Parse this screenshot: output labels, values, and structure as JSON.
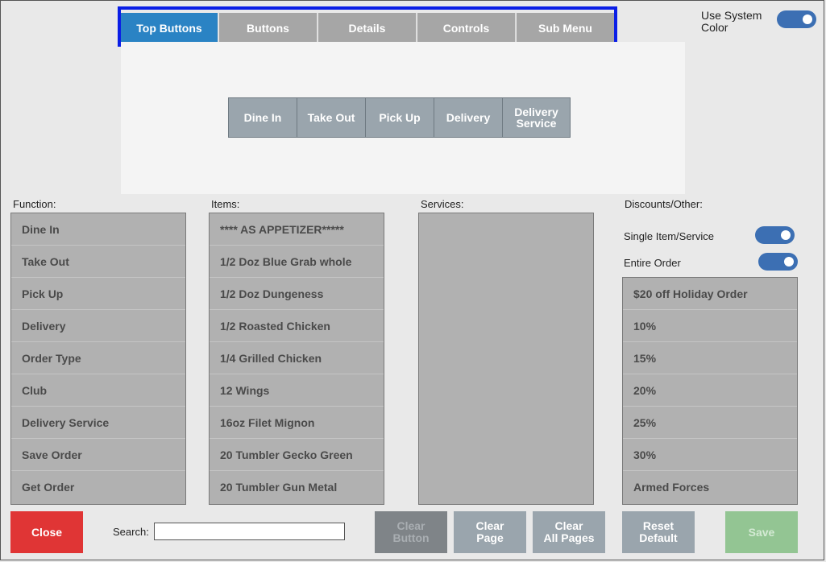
{
  "tabs": [
    {
      "label": "Top Buttons",
      "active": true
    },
    {
      "label": "Buttons",
      "active": false
    },
    {
      "label": "Details",
      "active": false
    },
    {
      "label": "Controls",
      "active": false
    },
    {
      "label": "Sub Menu",
      "active": false
    }
  ],
  "use_system_color": {
    "label_line1": "Use System",
    "label_line2": "Color",
    "enabled": true
  },
  "preview_buttons": [
    {
      "line1": "Dine In",
      "line2": ""
    },
    {
      "line1": "Take Out",
      "line2": ""
    },
    {
      "line1": "Pick Up",
      "line2": ""
    },
    {
      "line1": "Delivery",
      "line2": ""
    },
    {
      "line1": "Delivery",
      "line2": "Service"
    }
  ],
  "labels": {
    "function": "Function:",
    "items": "Items:",
    "services": "Services:",
    "discounts": "Discounts/Other:",
    "single_item": "Single Item/Service",
    "entire_order": "Entire Order",
    "search": "Search:"
  },
  "toggles": {
    "single_item": true,
    "entire_order": true
  },
  "function_list": [
    "Dine In",
    "Take Out",
    "Pick Up",
    "Delivery",
    "Order Type",
    "Club",
    "Delivery Service",
    "Save Order",
    "Get Order"
  ],
  "items_list": [
    "**** AS APPETIZER*****",
    "1/2 Doz Blue Grab whole",
    "1/2 Doz Dungeness",
    "1/2 Roasted Chicken",
    "1/4 Grilled Chicken",
    "12 Wings",
    "16oz Filet Mignon",
    "20 Tumbler Gecko Green",
    "20 Tumbler Gun Metal"
  ],
  "services_list": [],
  "discounts_list": [
    "$20 off Holiday Order",
    "10%",
    "15%",
    "20%",
    "25%",
    "30%",
    "Armed Forces"
  ],
  "search": {
    "value": "",
    "placeholder": ""
  },
  "buttons": {
    "close": "Close",
    "clear_button_1": "Clear",
    "clear_button_2": "Button",
    "clear_page_1": "Clear",
    "clear_page_2": "Page",
    "clear_all_1": "Clear",
    "clear_all_2": "All Pages",
    "reset_1": "Reset",
    "reset_2": "Default",
    "save": "Save"
  },
  "colors": {
    "accent": "#2a83c4",
    "tab_border": "#0a1ee6",
    "toggle": "#3c6fb3",
    "close": "#e03535",
    "save_disabled": "#93c593",
    "clear_button_disabled": "#7f8488",
    "secondary_button": "#9aa5ad"
  }
}
